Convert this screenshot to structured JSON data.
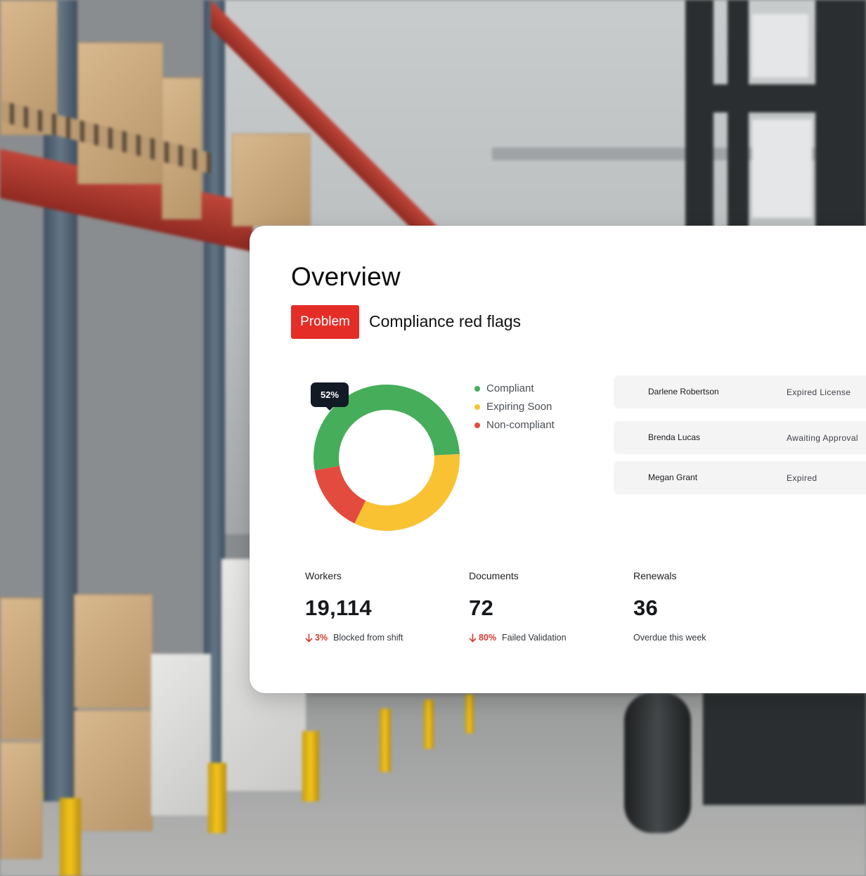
{
  "overview": {
    "title": "Overview",
    "badge": "Problem",
    "subtitle": "Compliance red flags"
  },
  "chart_data": {
    "type": "pie",
    "variant": "donut",
    "tooltip": "52%",
    "slices": [
      {
        "name": "Compliant",
        "value": 52,
        "color": "#46ad5a"
      },
      {
        "name": "Expiring Soon",
        "value": 33,
        "color": "#f8c232"
      },
      {
        "name": "Non-compliant",
        "value": 15,
        "color": "#e34b3e"
      }
    ]
  },
  "legend": [
    {
      "label": "Compliant",
      "color": "#46ad5a"
    },
    {
      "label": "Expiring Soon",
      "color": "#f8c232"
    },
    {
      "label": "Non-compliant",
      "color": "#e34b3e"
    }
  ],
  "flags": [
    {
      "name": "Darlene Robertson",
      "status": "Expired License"
    },
    {
      "name": "Brenda Lucas",
      "status": "Awaiting Approval"
    },
    {
      "name": "Megan Grant",
      "status": "Expired"
    }
  ],
  "stats": [
    {
      "label": "Workers",
      "value": "19,114",
      "pct": "3%",
      "note": "Blocked from shift"
    },
    {
      "label": "Documents",
      "value": "72",
      "pct": "80%",
      "note": "Failed Validation"
    },
    {
      "label": "Renewals",
      "value": "36",
      "pct": "",
      "note": "Overdue this week"
    }
  ],
  "colors": {
    "accent": "#e52d27",
    "down": "#d63a2f"
  },
  "icons": {
    "trend": "arrow-down-icon"
  }
}
